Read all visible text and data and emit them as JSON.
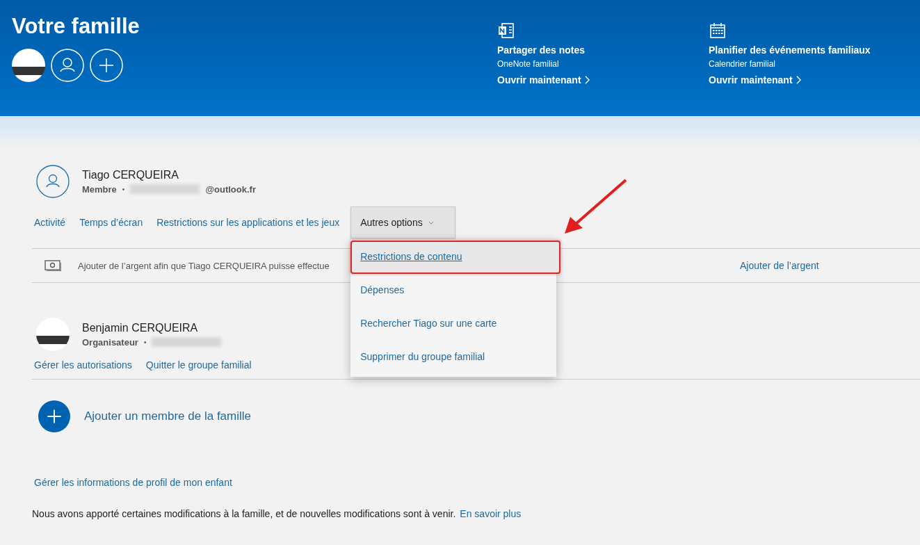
{
  "header": {
    "title": "Votre famille",
    "avatars": [
      {
        "kind": "photo"
      },
      {
        "kind": "person"
      },
      {
        "kind": "add"
      }
    ]
  },
  "promos": [
    {
      "kind": "notes",
      "title": "Partager des notes",
      "subtitle": "OneNote familial",
      "link": "Ouvrir maintenant"
    },
    {
      "kind": "calendar",
      "title": "Planifier des événements familiaux",
      "subtitle": "Calendrier familial",
      "link": "Ouvrir maintenant"
    }
  ],
  "members": [
    {
      "kind": "person",
      "name": "Tiago CERQUEIRA",
      "role": "Membre",
      "separator": "•",
      "email_hidden": true,
      "email_suffix": "@outlook.fr",
      "links": [
        "Activité",
        "Temps d’écran",
        "Restrictions sur les applications et les jeux"
      ],
      "more_button": "Autres options",
      "menu": {
        "expanded": true,
        "items": [
          {
            "label": "Restrictions de contenu",
            "selected": true
          },
          {
            "label": "Dépenses",
            "selected": false
          },
          {
            "label": "Rechercher Tiago sur une carte",
            "selected": false
          },
          {
            "label": "Supprimer du groupe familial",
            "selected": false
          }
        ]
      },
      "money_row": {
        "text": "Ajouter de l’argent afin que Tiago CERQUEIRA puisse effectue",
        "link": "Ajouter de l’argent"
      }
    },
    {
      "kind": "photo",
      "name": "Benjamin CERQUEIRA",
      "role": "Organisateur",
      "separator": "•",
      "email_hidden": true,
      "links": [
        "Gérer les autorisations",
        "Quitter le groupe familial"
      ]
    }
  ],
  "add_member": "Ajouter un membre de la famille",
  "profile_link": "Gérer les informations de profil de mon enfant",
  "footer": {
    "text": "Nous avons apporté certaines modifications à la famille, et de nouvelles modifications sont à venir.",
    "link": "En savoir plus"
  }
}
